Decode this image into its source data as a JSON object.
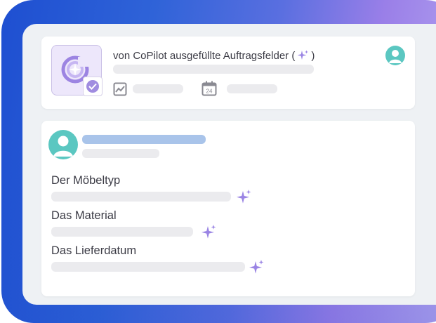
{
  "header": {
    "title_prefix": "von CoPilot ausgefüllte Auftragsfelder (",
    "title_suffix": ")"
  },
  "calendar_day": "24",
  "fields": [
    {
      "label": "Der Möbeltyp"
    },
    {
      "label": "Das Material"
    },
    {
      "label": "Das Lieferdatum"
    }
  ],
  "colors": {
    "accent_purple": "#8f7adf",
    "avatar_teal": "#5bc7c1",
    "name_bar_blue": "#a9c4ea",
    "placeholder_gray": "#ebebee"
  },
  "icons": [
    "copilot-logo-icon",
    "check-badge-icon",
    "sparkle-icon",
    "user-avatar-icon",
    "chart-icon",
    "calendar-icon"
  ]
}
